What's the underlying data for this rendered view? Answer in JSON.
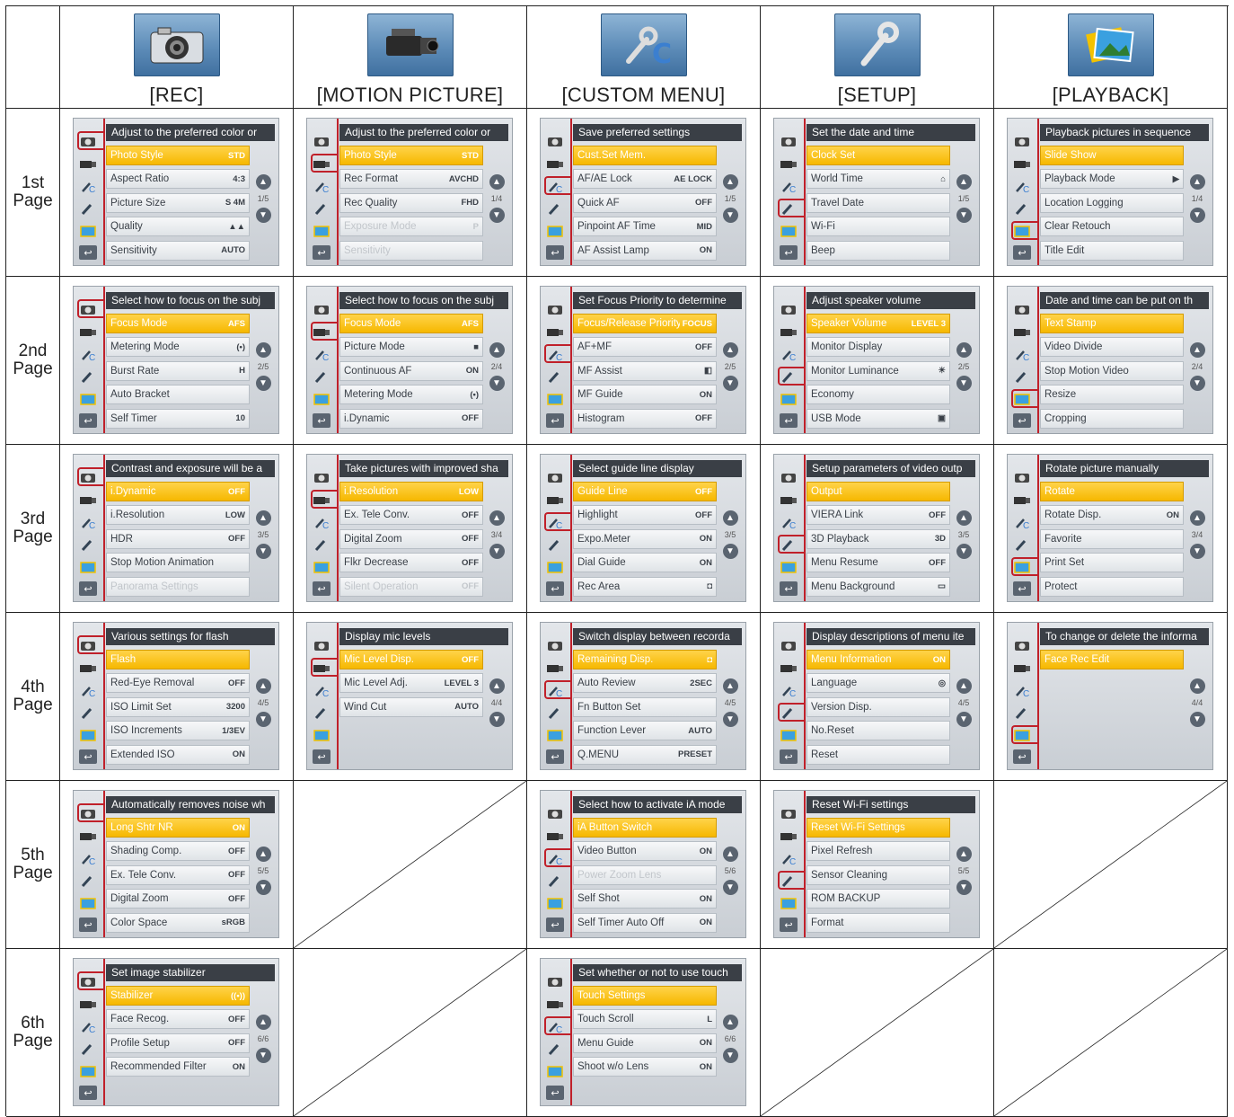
{
  "columns": [
    {
      "icon": "camera-icon",
      "label": "[REC]"
    },
    {
      "icon": "video-camera-icon",
      "label": "[MOTION PICTURE]"
    },
    {
      "icon": "wrench-c-icon",
      "label": "[CUSTOM MENU]"
    },
    {
      "icon": "wrench-icon",
      "label": "[SETUP]"
    },
    {
      "icon": "photos-icon",
      "label": "[PLAYBACK]"
    }
  ],
  "rows": [
    {
      "label": "1st\nPage"
    },
    {
      "label": "2nd\nPage"
    },
    {
      "label": "3rd\nPage"
    },
    {
      "label": "4th\nPage"
    },
    {
      "label": "5th\nPage"
    },
    {
      "label": "6th\nPage"
    }
  ],
  "grid": [
    [
      {
        "tab": 0,
        "title": "Adjust to the preferred color or",
        "page": "1/5",
        "items": [
          [
            "Photo Style",
            "STD"
          ],
          [
            "Aspect Ratio",
            "4:3"
          ],
          [
            "Picture Size",
            "S 4M"
          ],
          [
            "Quality",
            "▲▲"
          ],
          [
            "Sensitivity",
            "AUTO"
          ]
        ],
        "sel": 0,
        "dis": []
      },
      {
        "tab": 1,
        "title": "Adjust to the preferred color or",
        "page": "1/4",
        "items": [
          [
            "Photo Style",
            "STD"
          ],
          [
            "Rec Format",
            "AVCHD"
          ],
          [
            "Rec Quality",
            "FHD"
          ],
          [
            "Exposure Mode",
            "P"
          ],
          [
            "Sensitivity",
            ""
          ]
        ],
        "sel": 0,
        "dis": [
          3,
          4
        ]
      },
      {
        "tab": 2,
        "title": "Save preferred settings",
        "page": "1/5",
        "items": [
          [
            "Cust.Set Mem.",
            ""
          ],
          [
            "AF/AE Lock",
            "AE LOCK"
          ],
          [
            "Quick AF",
            "OFF"
          ],
          [
            "Pinpoint AF Time",
            "MID"
          ],
          [
            "AF Assist Lamp",
            "ON"
          ]
        ],
        "sel": 0,
        "dis": []
      },
      {
        "tab": 3,
        "title": "Set the date and time",
        "page": "1/5",
        "items": [
          [
            "Clock Set",
            ""
          ],
          [
            "World Time",
            "⌂"
          ],
          [
            "Travel Date",
            ""
          ],
          [
            "Wi-Fi",
            ""
          ],
          [
            "Beep",
            ""
          ]
        ],
        "sel": 0,
        "dis": []
      },
      {
        "tab": 4,
        "title": "Playback pictures in sequence",
        "page": "1/4",
        "items": [
          [
            "Slide Show",
            ""
          ],
          [
            "Playback Mode",
            "▶"
          ],
          [
            "Location Logging",
            ""
          ],
          [
            "Clear Retouch",
            ""
          ],
          [
            "Title Edit",
            ""
          ]
        ],
        "sel": 0,
        "dis": []
      }
    ],
    [
      {
        "tab": 0,
        "title": "Select how to focus on the subj",
        "page": "2/5",
        "items": [
          [
            "Focus Mode",
            "AFS"
          ],
          [
            "Metering Mode",
            "(•)"
          ],
          [
            "Burst Rate",
            "H"
          ],
          [
            "Auto Bracket",
            ""
          ],
          [
            "Self Timer",
            "10"
          ]
        ],
        "sel": 0,
        "dis": []
      },
      {
        "tab": 1,
        "title": "Select how to focus on the subj",
        "page": "2/4",
        "items": [
          [
            "Focus Mode",
            "AFS"
          ],
          [
            "Picture Mode",
            "■"
          ],
          [
            "Continuous AF",
            "ON"
          ],
          [
            "Metering Mode",
            "(•)"
          ],
          [
            "i.Dynamic",
            "OFF"
          ]
        ],
        "sel": 0,
        "dis": []
      },
      {
        "tab": 2,
        "title": "Set Focus Priority to determine",
        "page": "2/5",
        "items": [
          [
            "Focus/Release Priority",
            "FOCUS"
          ],
          [
            "AF+MF",
            "OFF"
          ],
          [
            "MF Assist",
            "◧"
          ],
          [
            "MF Guide",
            "ON"
          ],
          [
            "Histogram",
            "OFF"
          ]
        ],
        "sel": 0,
        "dis": []
      },
      {
        "tab": 3,
        "title": "Adjust speaker volume",
        "page": "2/5",
        "items": [
          [
            "Speaker Volume",
            "LEVEL 3"
          ],
          [
            "Monitor Display",
            ""
          ],
          [
            "Monitor Luminance",
            "☀"
          ],
          [
            "Economy",
            ""
          ],
          [
            "USB Mode",
            "▣"
          ]
        ],
        "sel": 0,
        "dis": []
      },
      {
        "tab": 4,
        "title": "Date and time can be put on th",
        "page": "2/4",
        "items": [
          [
            "Text Stamp",
            ""
          ],
          [
            "Video Divide",
            ""
          ],
          [
            "Stop Motion Video",
            ""
          ],
          [
            "Resize",
            ""
          ],
          [
            "Cropping",
            ""
          ]
        ],
        "sel": 0,
        "dis": []
      }
    ],
    [
      {
        "tab": 0,
        "title": "Contrast and exposure will be a",
        "page": "3/5",
        "items": [
          [
            "i.Dynamic",
            "OFF"
          ],
          [
            "i.Resolution",
            "LOW"
          ],
          [
            "HDR",
            "OFF"
          ],
          [
            "Stop Motion Animation",
            ""
          ],
          [
            "Panorama Settings",
            ""
          ]
        ],
        "sel": 0,
        "dis": [
          4
        ]
      },
      {
        "tab": 1,
        "title": "Take pictures with improved sha",
        "page": "3/4",
        "items": [
          [
            "i.Resolution",
            "LOW"
          ],
          [
            "Ex. Tele Conv.",
            "OFF"
          ],
          [
            "Digital Zoom",
            "OFF"
          ],
          [
            "Flkr Decrease",
            "OFF"
          ],
          [
            "Silent Operation",
            "OFF"
          ]
        ],
        "sel": 0,
        "dis": [
          4
        ]
      },
      {
        "tab": 2,
        "title": "Select guide line display",
        "page": "3/5",
        "items": [
          [
            "Guide Line",
            "OFF"
          ],
          [
            "Highlight",
            "OFF"
          ],
          [
            "Expo.Meter",
            "ON"
          ],
          [
            "Dial Guide",
            "ON"
          ],
          [
            "Rec Area",
            "◘"
          ]
        ],
        "sel": 0,
        "dis": []
      },
      {
        "tab": 3,
        "title": "Setup parameters of video outp",
        "page": "3/5",
        "items": [
          [
            "Output",
            ""
          ],
          [
            "VIERA Link",
            "OFF"
          ],
          [
            "3D Playback",
            "3D"
          ],
          [
            "Menu Resume",
            "OFF"
          ],
          [
            "Menu Background",
            "▭"
          ]
        ],
        "sel": 0,
        "dis": []
      },
      {
        "tab": 4,
        "title": "Rotate picture manually",
        "page": "3/4",
        "items": [
          [
            "Rotate",
            ""
          ],
          [
            "Rotate Disp.",
            "ON"
          ],
          [
            "Favorite",
            ""
          ],
          [
            "Print Set",
            ""
          ],
          [
            "Protect",
            ""
          ]
        ],
        "sel": 0,
        "dis": []
      }
    ],
    [
      {
        "tab": 0,
        "title": "Various settings for flash",
        "page": "4/5",
        "items": [
          [
            "Flash",
            ""
          ],
          [
            "Red-Eye Removal",
            "OFF"
          ],
          [
            "ISO Limit Set",
            "3200"
          ],
          [
            "ISO Increments",
            "1/3EV"
          ],
          [
            "Extended ISO",
            "ON"
          ]
        ],
        "sel": 0,
        "dis": []
      },
      {
        "tab": 1,
        "title": "Display mic levels",
        "page": "4/4",
        "items": [
          [
            "Mic Level Disp.",
            "OFF"
          ],
          [
            "Mic Level Adj.",
            "LEVEL 3"
          ],
          [
            "Wind Cut",
            "AUTO"
          ]
        ],
        "sel": 0,
        "dis": []
      },
      {
        "tab": 2,
        "title": "Switch display between recorda",
        "page": "4/5",
        "items": [
          [
            "Remaining Disp.",
            "◘"
          ],
          [
            "Auto Review",
            "2SEC"
          ],
          [
            "Fn Button Set",
            ""
          ],
          [
            "Function Lever",
            "AUTO"
          ],
          [
            "Q.MENU",
            "PRESET"
          ]
        ],
        "sel": 0,
        "dis": []
      },
      {
        "tab": 3,
        "title": "Display descriptions of menu ite",
        "page": "4/5",
        "items": [
          [
            "Menu Information",
            "ON"
          ],
          [
            "Language",
            "◎"
          ],
          [
            "Version Disp.",
            ""
          ],
          [
            "No.Reset",
            ""
          ],
          [
            "Reset",
            ""
          ]
        ],
        "sel": 0,
        "dis": []
      },
      {
        "tab": 4,
        "title": "To change or delete the informa",
        "page": "4/4",
        "items": [
          [
            "Face Rec Edit",
            ""
          ]
        ],
        "sel": 0,
        "dis": []
      }
    ],
    [
      {
        "tab": 0,
        "title": "Automatically removes noise wh",
        "page": "5/5",
        "items": [
          [
            "Long Shtr NR",
            "ON"
          ],
          [
            "Shading Comp.",
            "OFF"
          ],
          [
            "Ex. Tele Conv.",
            "OFF"
          ],
          [
            "Digital Zoom",
            "OFF"
          ],
          [
            "Color Space",
            "sRGB"
          ]
        ],
        "sel": 0,
        "dis": []
      },
      null,
      {
        "tab": 2,
        "title": "Select how to activate iA mode",
        "page": "5/6",
        "items": [
          [
            "iA Button Switch",
            ""
          ],
          [
            "Video Button",
            "ON"
          ],
          [
            "Power Zoom Lens",
            ""
          ],
          [
            "Self Shot",
            "ON"
          ],
          [
            "Self Timer Auto Off",
            "ON"
          ]
        ],
        "sel": 0,
        "dis": [
          2
        ]
      },
      {
        "tab": 3,
        "title": "Reset Wi-Fi settings",
        "page": "5/5",
        "items": [
          [
            "Reset Wi-Fi Settings",
            ""
          ],
          [
            "Pixel Refresh",
            ""
          ],
          [
            "Sensor Cleaning",
            ""
          ],
          [
            "ROM BACKUP",
            ""
          ],
          [
            "Format",
            ""
          ]
        ],
        "sel": 0,
        "dis": []
      },
      null
    ],
    [
      {
        "tab": 0,
        "title": "Set image stabilizer",
        "page": "6/6",
        "items": [
          [
            "Stabilizer",
            "((•))"
          ],
          [
            "Face Recog.",
            "OFF"
          ],
          [
            "Profile Setup",
            "OFF"
          ],
          [
            "Recommended Filter",
            "ON"
          ]
        ],
        "sel": 0,
        "dis": []
      },
      null,
      {
        "tab": 2,
        "title": "Set whether or not to use touch",
        "page": "6/6",
        "items": [
          [
            "Touch Settings",
            ""
          ],
          [
            "Touch Scroll",
            "L"
          ],
          [
            "Menu Guide",
            "ON"
          ],
          [
            "Shoot w/o Lens",
            "ON"
          ]
        ],
        "sel": 0,
        "dis": []
      },
      null,
      null
    ]
  ],
  "colors": {
    "selected": "#f6b800",
    "title_bar": "#3a3f46",
    "red_tab": "#c0202a",
    "icon_bg": "#5d8cb8"
  }
}
